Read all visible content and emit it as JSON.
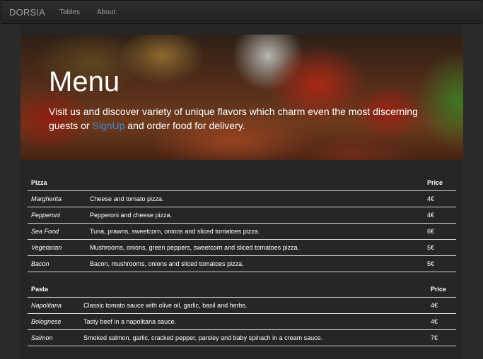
{
  "navbar": {
    "brand": "DORSIA",
    "links": [
      {
        "label": "Tables"
      },
      {
        "label": "About"
      }
    ]
  },
  "hero": {
    "title": "Menu",
    "text_before": "Visit us and discover variety of unique flavors which charm even the most discerning guests or ",
    "link_label": "SignUp",
    "text_after": " and order food for delivery.",
    "link_color": "#3d8cd8"
  },
  "pizza": {
    "header_name": "Pizza",
    "header_price": "Price",
    "rows": [
      {
        "name": "Margherita",
        "description": "Cheese and tomato pizza.",
        "price": "4€"
      },
      {
        "name": "Pepperoni",
        "description": "Pepperoni and cheese pizza.",
        "price": "4€"
      },
      {
        "name": "Sea Food",
        "description": "Tuna, prawns, sweetcorn, onions and sliced tomatoes pizza.",
        "price": "6€"
      },
      {
        "name": "Vegetarian",
        "description": "Mushrooms, onions, green peppers, sweetcorn and sliced tomatoes pizza.",
        "price": "5€"
      },
      {
        "name": "Bacon",
        "description": "Bacon, mushrooms, onions and sliced tomatoes pizza.",
        "price": "5€"
      }
    ]
  },
  "pasta": {
    "header_name": "Pasta",
    "header_price": "Price",
    "rows": [
      {
        "name": "Napolitana",
        "description": "Classic tomato sauce with olive oil, garlic, basil and herbs.",
        "price": "4€"
      },
      {
        "name": "Bolognese",
        "description": "Tasty beef in a napolitana sauce.",
        "price": "4€"
      },
      {
        "name": "Salmon",
        "description": "Smoked salmon, garlic, cracked pepper, parsley and baby spinach in a cream sauce.",
        "price": "7€"
      }
    ]
  }
}
